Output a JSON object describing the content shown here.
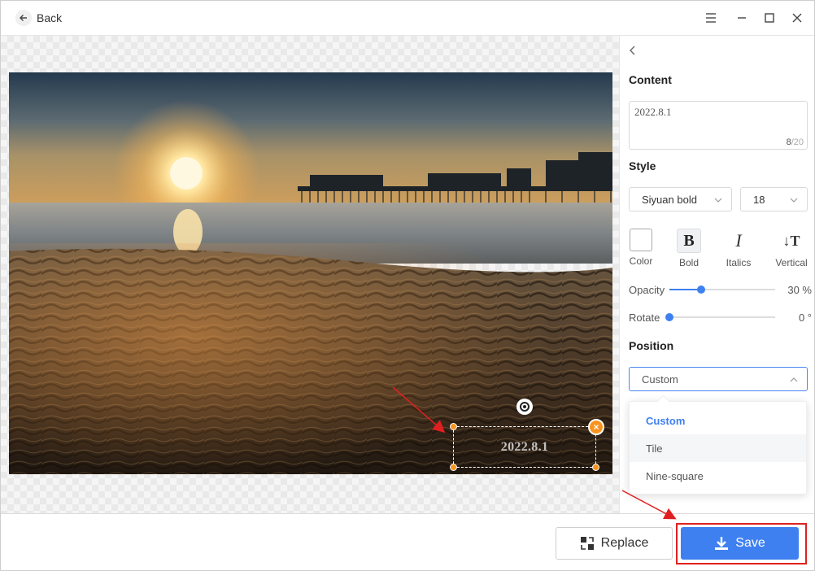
{
  "titlebar": {
    "back_label": "Back",
    "icons": [
      "arrow-left-icon",
      "menu-icon",
      "minimize-icon",
      "maximize-icon",
      "close-icon"
    ]
  },
  "canvas": {
    "watermark_text": "2022.8.1"
  },
  "panel": {
    "content_label": "Content",
    "content_value": "2022.8.1",
    "char_count": "8",
    "char_max": "/20",
    "style_label": "Style",
    "font_value": "Siyuan bold",
    "size_value": "18",
    "style_buttons": {
      "color": "Color",
      "bold": "Bold",
      "italics": "Italics",
      "vertical": "Vertical"
    },
    "opacity": {
      "label": "Opacity",
      "value_text": "30 %",
      "value": 0.3
    },
    "rotate": {
      "label": "Rotate",
      "value_text": "0 °",
      "value": 0
    },
    "position_label": "Position",
    "position_value": "Custom",
    "position_options": [
      "Custom",
      "Tile",
      "Nine-square"
    ]
  },
  "footer": {
    "replace_label": "Replace",
    "save_label": "Save"
  },
  "colors": {
    "accent": "#3f80f0",
    "handle": "#f7931e",
    "annotation": "#e02020"
  }
}
